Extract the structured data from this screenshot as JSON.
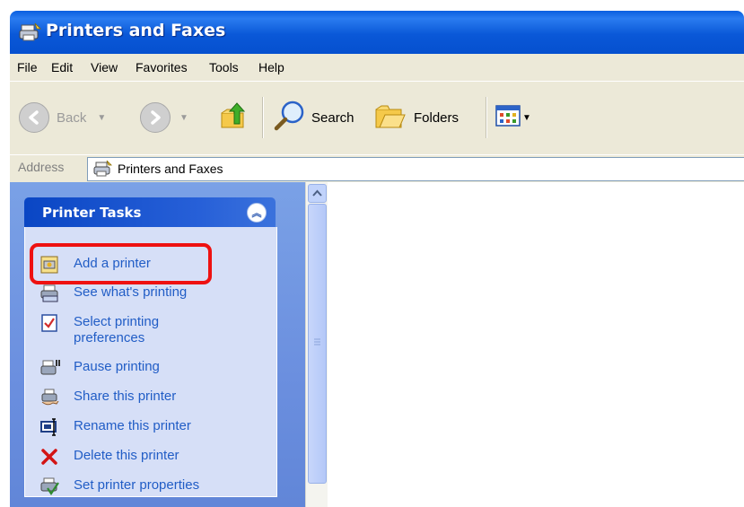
{
  "window": {
    "title": "Printers and Faxes",
    "title_icon": "printer-fax-icon"
  },
  "menu": [
    "File",
    "Edit",
    "View",
    "Favorites",
    "Tools",
    "Help"
  ],
  "toolbar": {
    "back_label": "Back",
    "search_label": "Search",
    "folders_label": "Folders",
    "icons": [
      "back-arrow-icon",
      "forward-arrow-icon",
      "up-folder-icon",
      "search-icon",
      "folders-icon",
      "views-icon"
    ]
  },
  "address": {
    "label": "Address",
    "value": "Printers and Faxes"
  },
  "tasks_panel": {
    "title": "Printer Tasks",
    "items": [
      {
        "label": "Add a printer",
        "icon": "add-printer-icon"
      },
      {
        "label": "See what's printing",
        "icon": "printer-queue-icon"
      },
      {
        "label": "Select printing preferences",
        "line1": "Select printing",
        "line2": "preferences",
        "icon": "preferences-check-icon"
      },
      {
        "label": "Pause printing",
        "icon": "pause-printer-icon"
      },
      {
        "label": "Share this printer",
        "icon": "share-printer-icon"
      },
      {
        "label": "Rename this printer",
        "icon": "rename-icon"
      },
      {
        "label": "Delete this printer",
        "icon": "delete-x-icon"
      },
      {
        "label": "Set printer properties",
        "icon": "printer-properties-icon"
      }
    ]
  },
  "colors": {
    "title_bar": "#0a58d8",
    "task_header": "#0a46c4",
    "task_link": "#215dc6",
    "highlight": "#ee1111"
  }
}
